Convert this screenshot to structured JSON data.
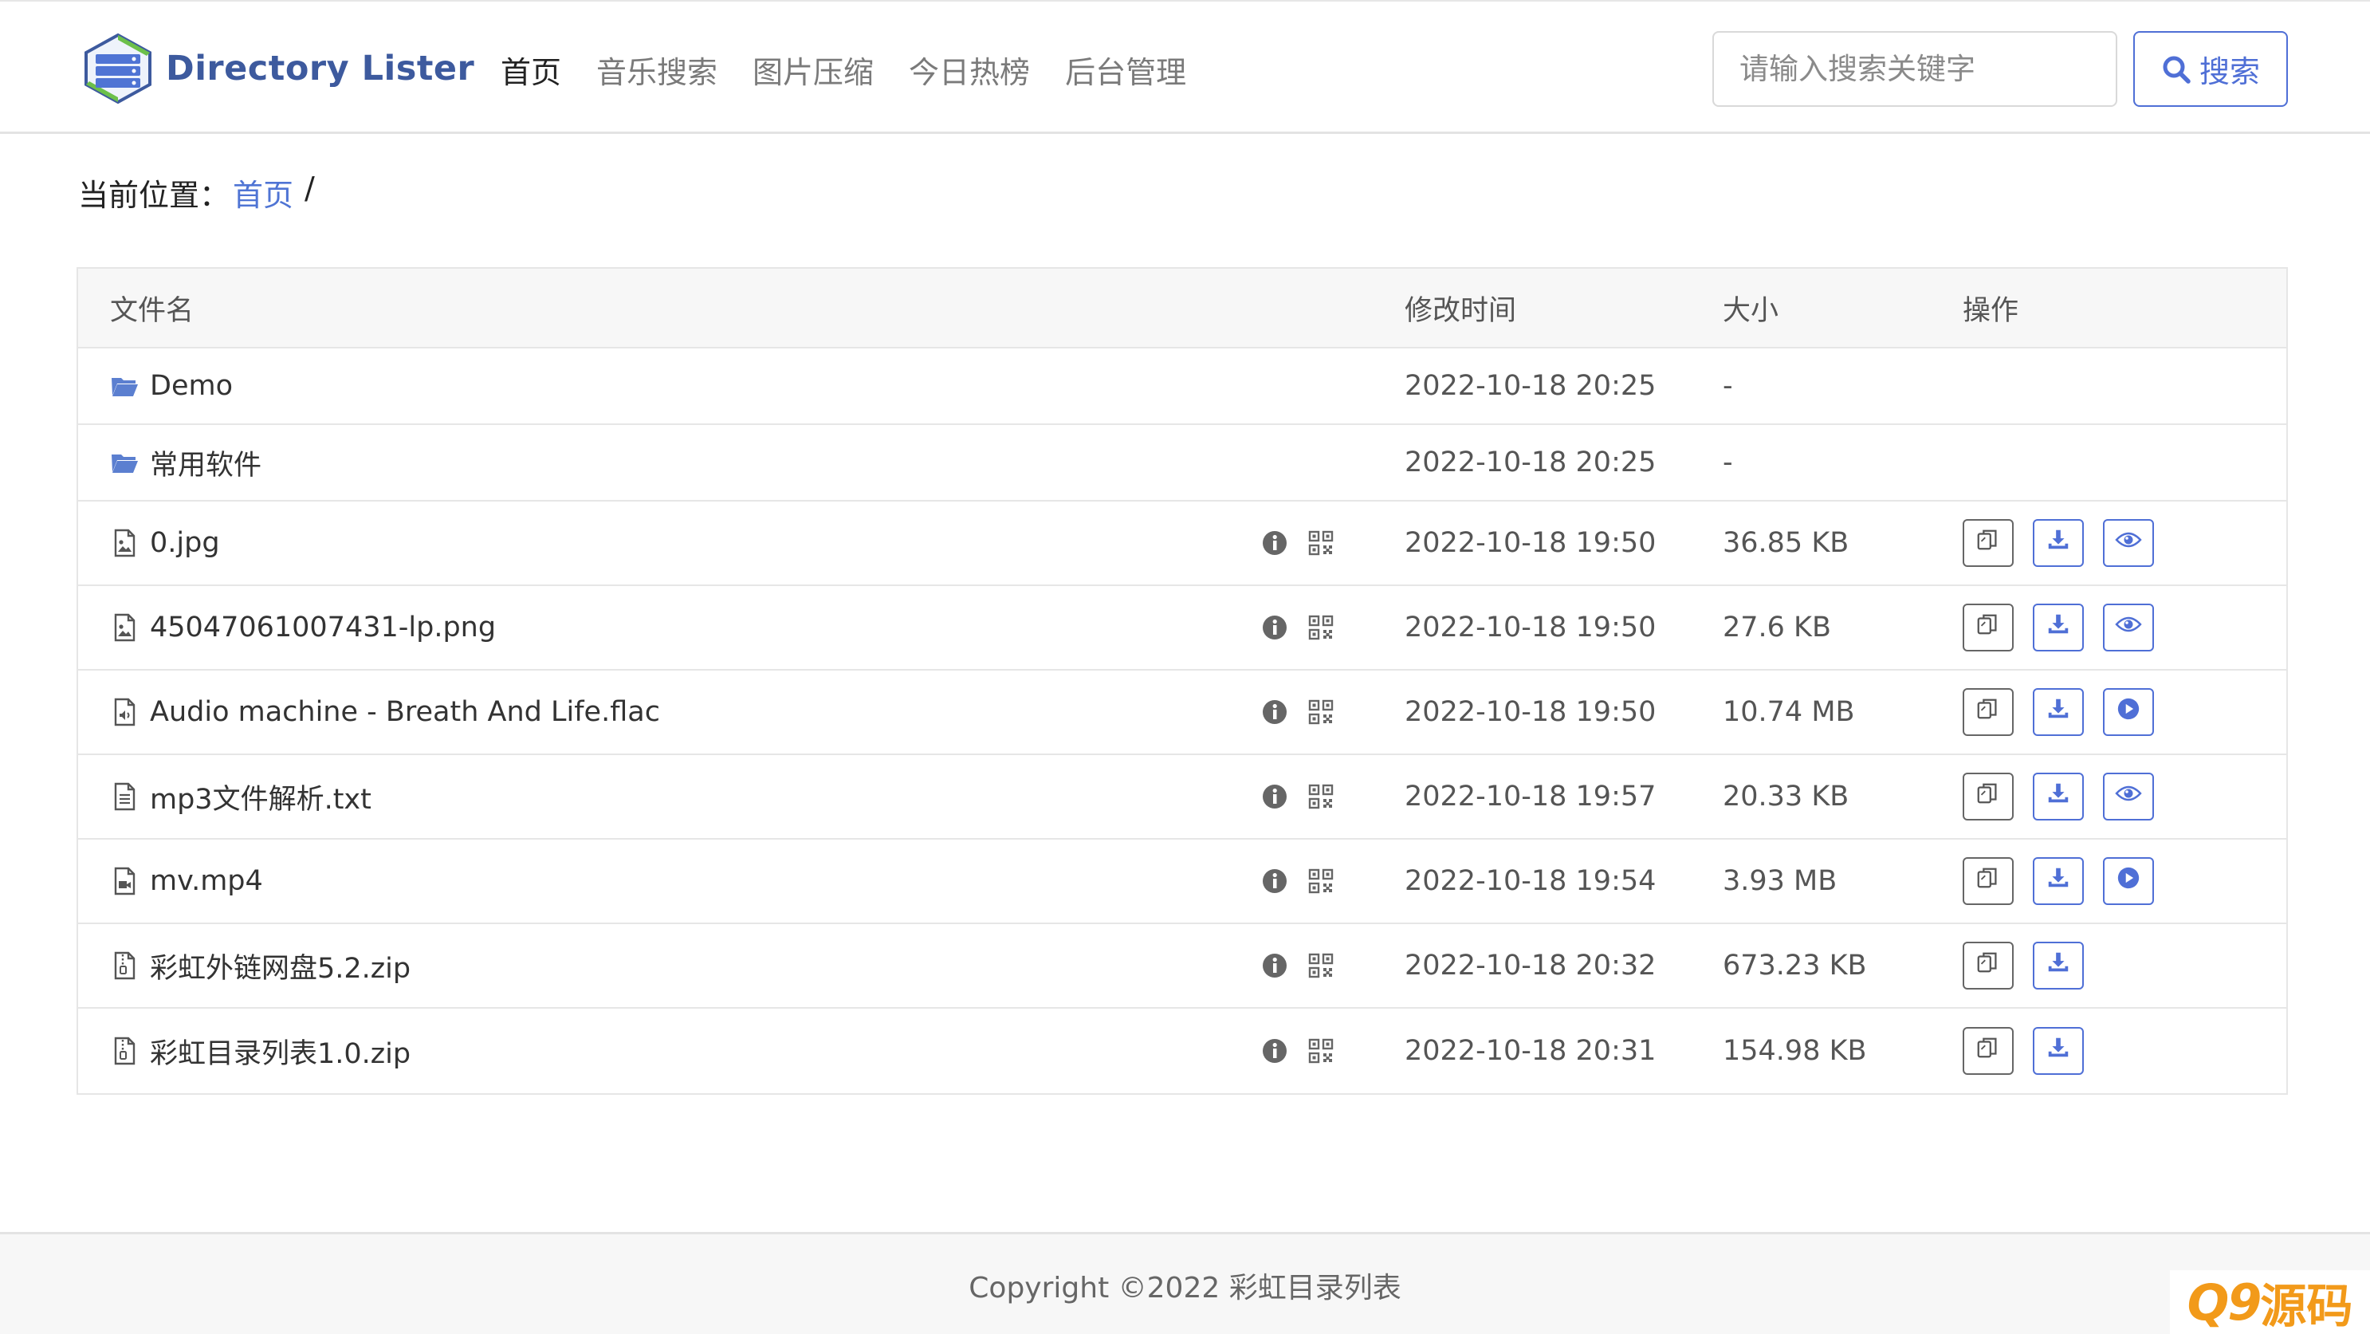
{
  "brand": {
    "name": "Directory Lister",
    "logo_icon": "server-stack-logo"
  },
  "nav": [
    {
      "label": "首页",
      "active": true
    },
    {
      "label": "音乐搜索",
      "active": false
    },
    {
      "label": "图片压缩",
      "active": false
    },
    {
      "label": "今日热榜",
      "active": false
    },
    {
      "label": "后台管理",
      "active": false
    }
  ],
  "search": {
    "placeholder": "请输入搜索关键字",
    "value": "",
    "button_label": "搜索",
    "button_icon": "search-icon"
  },
  "breadcrumb": {
    "prefix": "当前位置：",
    "home": "首页",
    "separator": "/"
  },
  "table": {
    "headers": {
      "name": "文件名",
      "time": "修改时间",
      "size": "大小",
      "ops": "操作"
    },
    "rows": [
      {
        "type": "folder",
        "icon": "folder-open-icon",
        "name": "Demo",
        "time": "2022-10-18 20:25",
        "size": "-"
      },
      {
        "type": "folder",
        "icon": "folder-open-icon",
        "name": "常用软件",
        "time": "2022-10-18 20:25",
        "size": "-"
      },
      {
        "type": "file",
        "icon": "image-file-icon",
        "name": "0.jpg",
        "time": "2022-10-18 19:50",
        "size": "36.85 KB",
        "third_action": "preview-eye-icon"
      },
      {
        "type": "file",
        "icon": "image-file-icon",
        "name": "45047061007431-lp.png",
        "time": "2022-10-18 19:50",
        "size": "27.6 KB",
        "third_action": "preview-eye-icon"
      },
      {
        "type": "file",
        "icon": "audio-file-icon",
        "name": "Audio machine - Breath And Life.flac",
        "time": "2022-10-18 19:50",
        "size": "10.74 MB",
        "third_action": "play-icon"
      },
      {
        "type": "file",
        "icon": "text-file-icon",
        "name": "mp3文件解析.txt",
        "time": "2022-10-18 19:57",
        "size": "20.33 KB",
        "third_action": "preview-eye-icon"
      },
      {
        "type": "file",
        "icon": "video-file-icon",
        "name": "mv.mp4",
        "time": "2022-10-18 19:54",
        "size": "3.93 MB",
        "third_action": "play-icon"
      },
      {
        "type": "file",
        "icon": "zip-file-icon",
        "name": "彩虹外链网盘5.2.zip",
        "time": "2022-10-18 20:32",
        "size": "673.23 KB",
        "third_action": null
      },
      {
        "type": "file",
        "icon": "zip-file-icon",
        "name": "彩虹目录列表1.0.zip",
        "time": "2022-10-18 20:31",
        "size": "154.98 KB",
        "third_action": null
      }
    ]
  },
  "footer": {
    "copyright": "Copyright ©2022 彩虹目录列表"
  },
  "watermark": {
    "part1": "Q9",
    "part2": "源码"
  },
  "colors": {
    "accent": "#4f6fd6",
    "brand": "#3d5a9e",
    "folder": "#5b7fd0",
    "watermark": "#f29a1a"
  }
}
